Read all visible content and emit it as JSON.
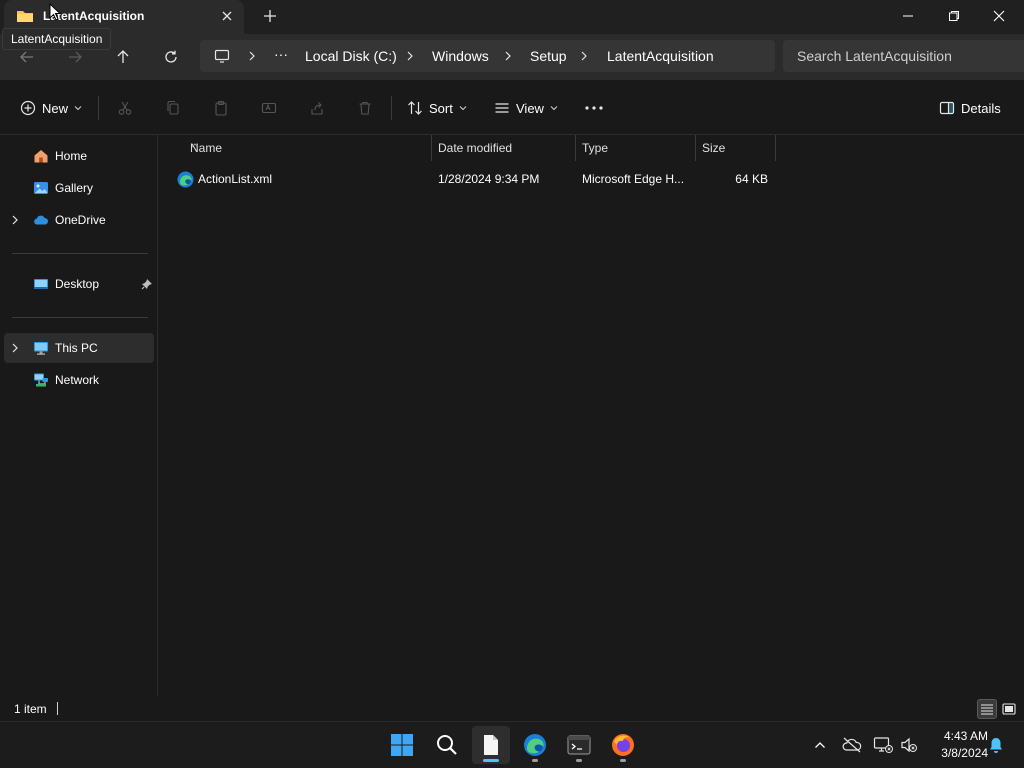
{
  "window": {
    "tab_title": "LatentAcquisition",
    "tooltip": "LatentAcquisition"
  },
  "address": {
    "overflow": "···",
    "crumbs": [
      "Local Disk (C:)",
      "Windows",
      "Setup",
      "LatentAcquisition"
    ],
    "search_placeholder": "Search LatentAcquisition"
  },
  "commands": {
    "new_label": "New",
    "sort_label": "Sort",
    "view_label": "View",
    "details_label": "Details"
  },
  "nav": {
    "items": [
      {
        "label": "Home",
        "icon": "home-icon"
      },
      {
        "label": "Gallery",
        "icon": "gallery-icon"
      },
      {
        "label": "OneDrive",
        "icon": "onedrive-icon"
      },
      {
        "label": "Desktop",
        "icon": "desktop-folder-icon"
      },
      {
        "label": "This PC",
        "icon": "this-pc-icon"
      },
      {
        "label": "Network",
        "icon": "network-icon"
      }
    ]
  },
  "columns": {
    "name": "Name",
    "date": "Date modified",
    "type": "Type",
    "size": "Size"
  },
  "files": [
    {
      "name": "ActionList.xml",
      "date": "1/28/2024 9:34 PM",
      "type": "Microsoft Edge H...",
      "size": "64 KB",
      "icon": "edge-document-icon"
    }
  ],
  "status": {
    "count": "1 item"
  },
  "taskbar": {
    "time": "4:43 AM",
    "date": "3/8/2024"
  },
  "colors": {
    "background": "#191919",
    "chrome": "#2b2b2b",
    "accent": "#4cc2ff",
    "folder": "#f8c44f"
  }
}
